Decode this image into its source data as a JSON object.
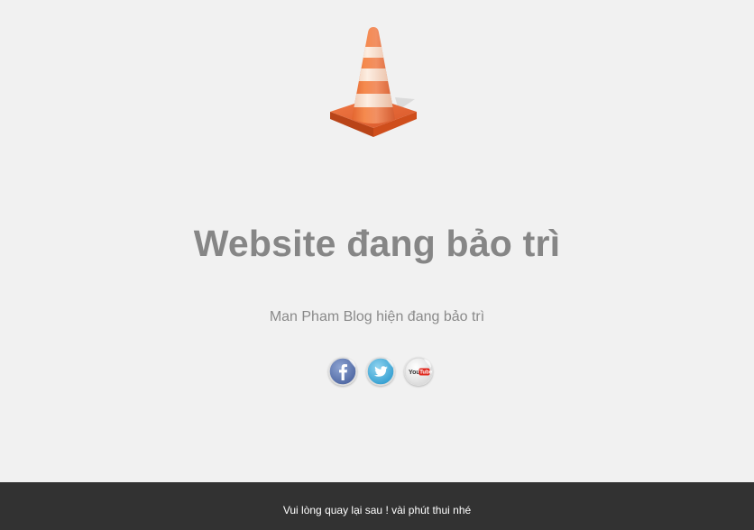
{
  "main": {
    "title": "Website đang bảo trì",
    "subtitle": "Man Pham Blog hiện đang bảo trì"
  },
  "icons": {
    "cone": "traffic-cone-icon",
    "facebook": "facebook-icon",
    "twitter": "twitter-icon",
    "youtube": "youtube-icon"
  },
  "social": {
    "youtube_logo_text": "YouTube"
  },
  "footer": {
    "text": "Vui lòng quay lại sau ! vài phút thui nhé"
  },
  "colors": {
    "background": "#f1f1f1",
    "title": "#868686",
    "subtitle": "#8a8a8a",
    "footer_background": "#323232",
    "footer_text": "#ffffff",
    "cone_orange": "#e8632c",
    "cone_stripe": "#f8dcc7"
  }
}
